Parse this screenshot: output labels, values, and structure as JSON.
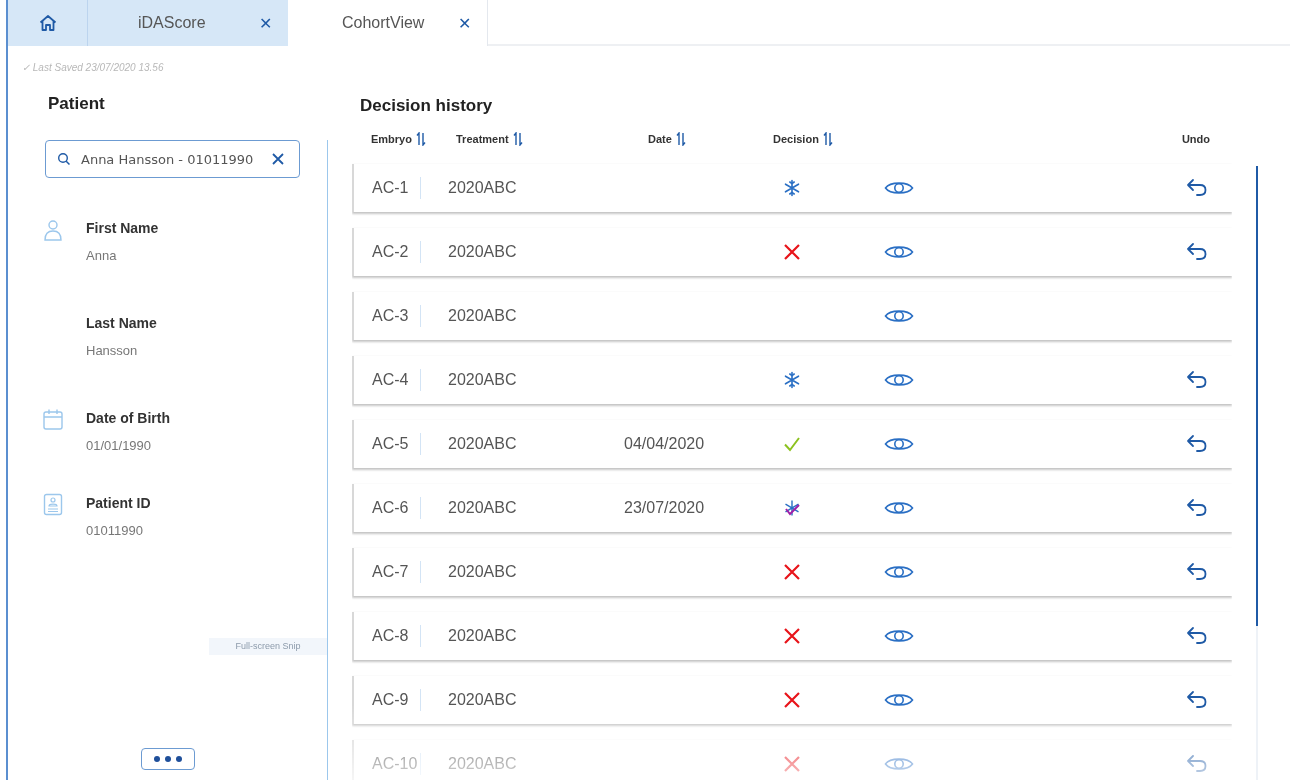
{
  "tabs": [
    {
      "kind": "home",
      "selected": false
    },
    {
      "kind": "text",
      "label": "iDAScore",
      "close": "✕",
      "selected": false
    },
    {
      "kind": "text",
      "label": "CohortView",
      "close": "✕",
      "selected": true
    }
  ],
  "last_saved": "✓ Last Saved  23/07/2020 13.56",
  "patient": {
    "title": "Patient",
    "search": {
      "value": "Anna Hansson - 01011990"
    },
    "fields": [
      {
        "kind": "person",
        "label": "First Name",
        "value": "Anna"
      },
      {
        "kind": "plain",
        "label": "Last Name",
        "value": "Hansson"
      },
      {
        "kind": "calendar",
        "label": "Date of Birth",
        "value": "01/01/1990"
      },
      {
        "kind": "badge",
        "label": "Patient ID",
        "value": "01011990"
      }
    ],
    "tooltip": "Full-screen Snip"
  },
  "history": {
    "title": "Decision history",
    "columns": [
      {
        "label": "Embryo",
        "sortable": true
      },
      {
        "label": "Treatment",
        "sortable": true
      },
      {
        "label": "Date",
        "sortable": true
      },
      {
        "label": "Decision",
        "sortable": true
      },
      {
        "label": "Undo",
        "sortable": false
      }
    ],
    "rows": [
      {
        "embryo": "AC-1",
        "treatment": "2020ABC",
        "kind": "freeze",
        "undo": true
      },
      {
        "embryo": "AC-2",
        "treatment": "2020ABC",
        "kind": "discard",
        "undo": true
      },
      {
        "embryo": "AC-3",
        "treatment": "2020ABC",
        "kind": "pending",
        "undo": false
      },
      {
        "embryo": "AC-4",
        "treatment": "2020ABC",
        "kind": "freeze",
        "undo": true
      },
      {
        "embryo": "AC-5",
        "treatment": "2020ABC",
        "date": "04/04/2020",
        "kind": "transfer",
        "undo": true
      },
      {
        "embryo": "AC-6",
        "treatment": "2020ABC",
        "date": "23/07/2020",
        "kind": "freezetransfer",
        "undo": true
      },
      {
        "embryo": "AC-7",
        "treatment": "2020ABC",
        "kind": "discard",
        "undo": true
      },
      {
        "embryo": "AC-8",
        "treatment": "2020ABC",
        "kind": "discard",
        "undo": true
      },
      {
        "embryo": "AC-9",
        "treatment": "2020ABC",
        "kind": "discard",
        "undo": true
      },
      {
        "embryo": "AC-10",
        "treatment": "2020ABC",
        "kind": "discard",
        "undo": true
      }
    ]
  }
}
